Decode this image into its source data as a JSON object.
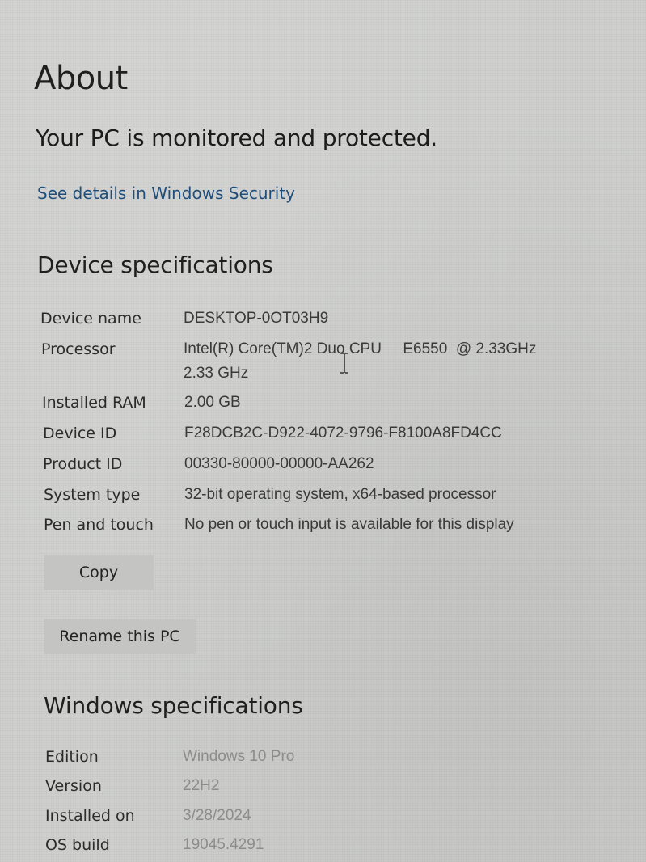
{
  "page": {
    "title": "About",
    "protection_status": "Your PC is monitored and protected.",
    "security_link": "See details in Windows Security"
  },
  "device_specs": {
    "title": "Device specifications",
    "rows": [
      {
        "label": "Device name",
        "value": "DESKTOP-0OT03H9"
      },
      {
        "label": "Processor",
        "value": "Intel(R) Core(TM)2 Duo CPU     E6550  @ 2.33GHz",
        "value2": "2.33 GHz"
      },
      {
        "label": "Installed RAM",
        "value": "2.00 GB"
      },
      {
        "label": "Device ID",
        "value": "F28DCB2C-D922-4072-9796-F8100A8FD4CC"
      },
      {
        "label": "Product ID",
        "value": "00330-80000-00000-AA262"
      },
      {
        "label": "System type",
        "value": "32-bit operating system, x64-based processor"
      },
      {
        "label": "Pen and touch",
        "value": "No pen or touch input is available for this display"
      }
    ],
    "copy_button": "Copy",
    "rename_button": "Rename this PC"
  },
  "windows_specs": {
    "title": "Windows specifications",
    "rows": [
      {
        "label": "Edition",
        "value": "Windows 10 Pro"
      },
      {
        "label": "Version",
        "value": "22H2"
      },
      {
        "label": "Installed on",
        "value": "3/28/2024"
      },
      {
        "label": "OS build",
        "value": "19045.4291"
      }
    ]
  },
  "cursor": {
    "icon": "text-cursor-icon"
  }
}
